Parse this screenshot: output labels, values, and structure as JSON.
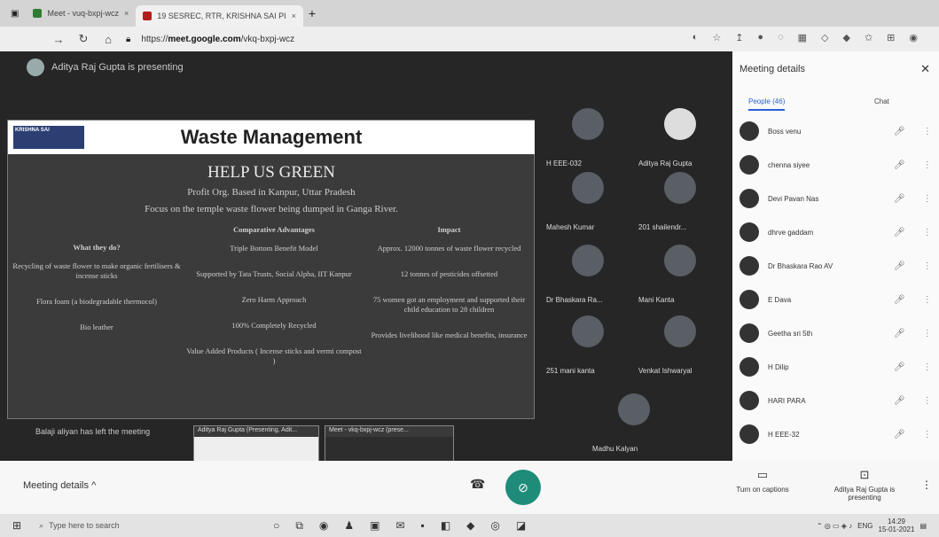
{
  "browser": {
    "tabs": [
      {
        "label": "Meet - vuq-bxpj-wcz"
      },
      {
        "label": "19 SESREC, RTR, KRISHNA SAI PI"
      }
    ],
    "new_tab": "+",
    "url_prefix": "https://",
    "url_host": "meet.google.com",
    "url_path": "/vkq-bxpj-wcz"
  },
  "stage": {
    "presenting_text": "Aditya Raj Gupta is presenting",
    "left_note": "Balaji aliyan has left the meeting"
  },
  "slide": {
    "title": "Waste Management",
    "logo_text": "KRISHNA SAI",
    "heading": "HELP US GREEN",
    "line1": "Profit Org. Based in Kanpur, Uttar Pradesh",
    "line2": "Focus on the temple waste flower being dumped in Ganga River.",
    "col_what": {
      "head": "What they do?",
      "items": [
        "Recycling of waste flower to make organic fertilisers & incense sticks",
        "Flora foam (a biodegradable thermocol)",
        "Bio leather"
      ]
    },
    "col_comp": {
      "head": "Comparative Advantages",
      "items": [
        "Triple Bottom Benefit Model",
        "Supported by Tata Trusts, Social Alpha, IIT Kanpur",
        "Zero Harm Approach",
        "100% Completely Recycled",
        "Value Added Products ( Incense sticks and vermi compost )"
      ]
    },
    "col_imp": {
      "head": "Impact",
      "items": [
        "Approx. 12000 tonnes of waste flower recycled",
        "12 tonnes of pesticides offsetted",
        "75 women got an employment and supported their child education to 28 children",
        "Provides livelihood like medical benefits, insurance"
      ]
    }
  },
  "tiles": [
    {
      "name": "H EEE-032"
    },
    {
      "name": "Aditya Raj Gupta"
    },
    {
      "name": "Mahesh Kumar"
    },
    {
      "name": "201 shailendr..."
    },
    {
      "name": "Dr Bhaskara Ra..."
    },
    {
      "name": "Mani Kanta"
    },
    {
      "name": "251 mani kanta"
    },
    {
      "name": "Venkat Ishwaryal"
    },
    {
      "name": "Madhu Kalyan"
    }
  ],
  "thumbs": [
    {
      "label": "Aditya Raj Gupta (Presenting, Adit..."
    },
    {
      "label": "Meet - vkq-bxpj-wcz (prese..."
    }
  ],
  "bottom": {
    "meeting_details": "Meeting details",
    "captions_label": "Turn on captions",
    "presenting_label": "Aditya Raj Gupta is presenting"
  },
  "panel": {
    "title": "Meeting details",
    "tab_people": "People (46)",
    "tab_chat": "Chat",
    "people": [
      {
        "name": "Boss venu"
      },
      {
        "name": "chenna siyee"
      },
      {
        "name": "Devi Pavan Nas"
      },
      {
        "name": "dhrve gaddam"
      },
      {
        "name": "Dr Bhaskara Rao AV"
      },
      {
        "name": "E Dava"
      },
      {
        "name": "Geetha sri 5th"
      },
      {
        "name": "H Dilip"
      },
      {
        "name": "HARI PARA"
      },
      {
        "name": "H EEE-32"
      }
    ]
  },
  "taskbar": {
    "search_placeholder": "Type here to search",
    "lang": "ENG",
    "time": "14:29",
    "date": "15-01-2021"
  },
  "colors": {
    "accent": "#1f8c7a",
    "tab_active": "#2b5ed8",
    "stage_bg": "#262626"
  }
}
